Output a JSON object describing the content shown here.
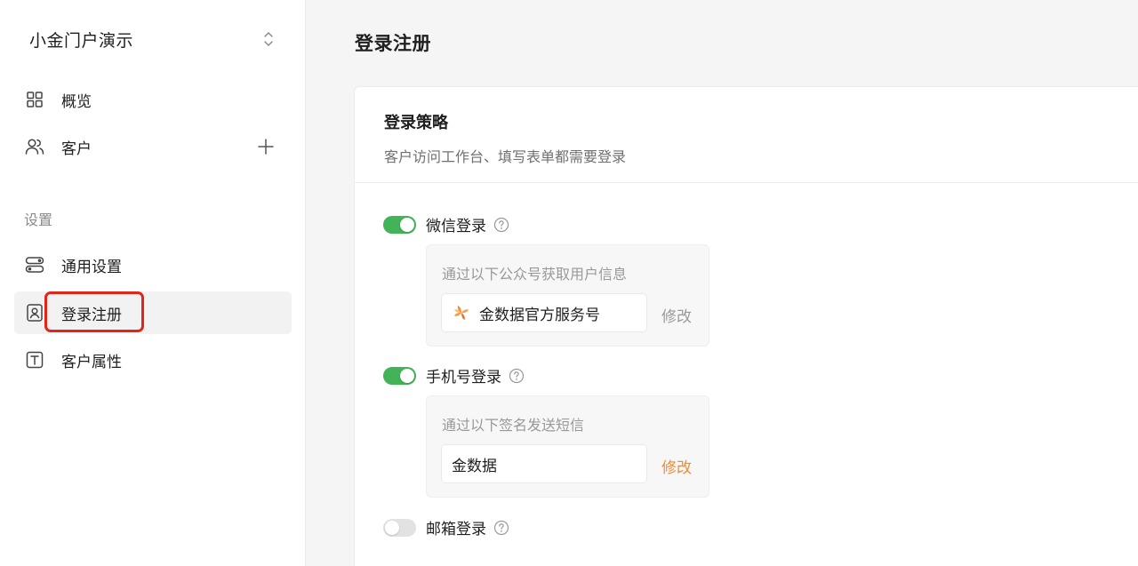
{
  "sidebar": {
    "portal_name": "小金门户演示",
    "nav": [
      {
        "label": "概览",
        "icon": "grid-icon"
      },
      {
        "label": "客户",
        "icon": "users-icon"
      }
    ],
    "settings_section": "设置",
    "settings": [
      {
        "label": "通用设置",
        "icon": "toggles-icon"
      },
      {
        "label": "登录注册",
        "icon": "login-badge-icon"
      },
      {
        "label": "客户属性",
        "icon": "text-field-icon"
      }
    ]
  },
  "main": {
    "page_title": "登录注册",
    "card": {
      "title": "登录策略",
      "subtitle": "客户访问工作台、填写表单都需要登录"
    },
    "wechat": {
      "label": "微信登录",
      "enabled": true,
      "hint": "通过以下公众号获取用户信息",
      "value": "金数据官方服务号",
      "edit_label": "修改",
      "edit_color": "#9a9a9a"
    },
    "phone": {
      "label": "手机号登录",
      "enabled": true,
      "hint": "通过以下签名发送短信",
      "value": "金数据",
      "edit_label": "修改",
      "edit_color": "#f28b34"
    },
    "email": {
      "label": "邮箱登录",
      "enabled": false
    }
  },
  "colors": {
    "toggle_on": "#42b356",
    "toggle_off": "#e2e2e2",
    "highlight": "#e0261b",
    "accent_orange": "#f28b34"
  }
}
